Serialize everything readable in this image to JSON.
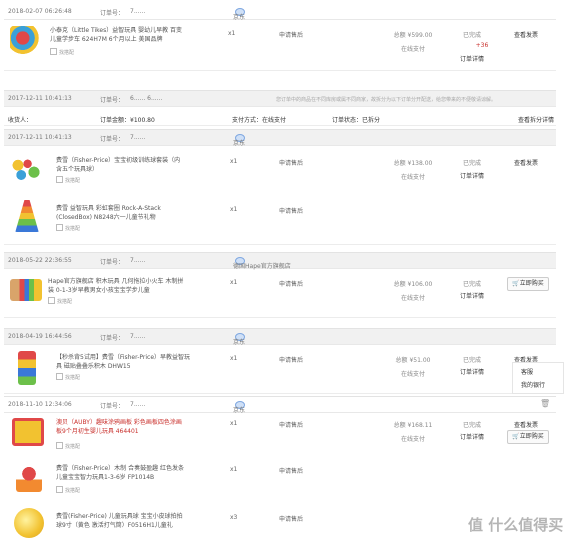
{
  "orders": [
    {
      "date": "2018-02-07 06:26:48",
      "order_label": "订单号：",
      "order_no": "7......",
      "shop": "京东",
      "products": [
        {
          "name": "小泰克（Little Tikes）益智玩具 婴幼儿早教 百变儿童学步车 624H7M 6个月以上 美国品牌",
          "find": "找搭配",
          "qty": "x1",
          "after": "申请售后"
        }
      ],
      "price": "总额 ¥599.00",
      "pay": "在线支付",
      "status": "已完成",
      "extra": "+36",
      "detail": "订单详情",
      "action": "查看发票"
    },
    {
      "date": "2017-12-11 10:41:13",
      "order_label": "订单号：",
      "order_no": "6...... 6......",
      "notice": "您订单中的商品在不同库房或属不同商家，故拆分为以下订单分开配送，给您带来的不便敬请谅解。",
      "summary": {
        "receiver": "收货人：",
        "amount": "订单金额：¥100.80",
        "payment": "支付方式：在线支付",
        "state": "订单状态：已拆分",
        "link": "查看拆分详情"
      }
    },
    {
      "date": "2017-12-11 10:41:13",
      "order_label": "订单号：",
      "order_no": "7......",
      "shop": "京东",
      "products": [
        {
          "name": "费雪（Fisher-Price）宝宝初级训练球套装（内含五个玩具球）",
          "find": "找搭配",
          "qty": "x1",
          "after": "申请售后"
        },
        {
          "name": "费雪 益智玩具 彩虹套圈 Rock-A-Stack (ClosedBox) N8248六一儿童节礼物",
          "find": "找搭配",
          "qty": "x1",
          "after": "申请售后"
        }
      ],
      "price": "总额 ¥138.00",
      "pay": "在线支付",
      "status": "已完成",
      "detail": "订单详情",
      "action": "查看发票"
    },
    {
      "date": "2018-05-22 22:36:55",
      "order_label": "订单号：",
      "order_no": "7......",
      "shop": "德国Hape官方旗舰店",
      "products": [
        {
          "name": "Hape官方旗舰店 积木玩具 几何拖拉小火车 木制拼装 0-1-3岁早教男女小孩宝宝学步儿童",
          "find": "找搭配",
          "qty": "x1",
          "after": "申请售后"
        }
      ],
      "price": "总额 ¥106.00",
      "pay": "在线支付",
      "status": "已完成",
      "detail": "订单详情",
      "action": "立即购买"
    },
    {
      "date": "2018-04-19 16:44:56",
      "order_label": "订单号：",
      "order_no": "7......",
      "shop": "京东",
      "products": [
        {
          "name": "【秒杀背5试用】费雪（Fisher-Price）早教益智玩具 磁贴叠叠乐积木 DHW15",
          "find": "找搭配",
          "qty": "x1",
          "after": "申请售后"
        }
      ],
      "price": "总额 ¥51.00",
      "pay": "在线支付",
      "status": "已完成",
      "detail": "订单详情",
      "action": "查看发票",
      "side1": "客服",
      "side2": "我的银行"
    },
    {
      "date": "2018-11-10 12:34:06",
      "order_label": "订单号：",
      "order_no": "7......",
      "shop": "京东",
      "products": [
        {
          "name": "澳贝（AUBY）趣味涂鸦画板 彩色画板四色涂画板9个月初生婴儿玩具 464401",
          "find": "找搭配",
          "qty": "x1",
          "after": "申请售后",
          "red": true
        },
        {
          "name": "费雪（Fisher-Price）木制 合奏鼓盈趣 红色发条儿童宝宝智力玩具1-3-6岁 FP1014B",
          "find": "找搭配",
          "qty": "x1",
          "after": "申请售后"
        },
        {
          "name": "费雪(Fisher-Price) 儿童玩具球 宝宝小皮球拍拍球9寸（黄色 激活打气筒）F0516H1儿童礼",
          "find": "找搭配",
          "qty": "x3",
          "after": "申请售后"
        }
      ],
      "price": "总额 ¥168.11",
      "pay": "在线支付",
      "status": "已完成",
      "detail": "订单详情",
      "action": "查看发票",
      "action2": "立即购买"
    }
  ],
  "watermark": "值 什么值得买",
  "colors": {
    "accent_red": "#c9302c",
    "link_blue": "#4a79c9",
    "header_bg": "#f1f1f1"
  }
}
